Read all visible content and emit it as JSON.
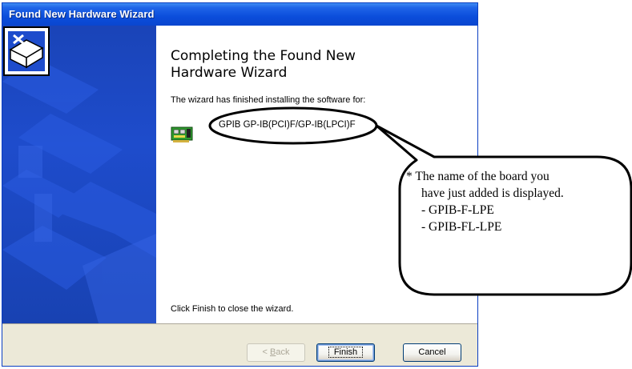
{
  "window": {
    "title": "Found New Hardware Wizard"
  },
  "content": {
    "heading_line1": "Completing the Found New",
    "heading_line2": "Hardware Wizard",
    "intro": "The wizard has finished installing the software for:",
    "device_name": "GPIB GP-IB(PCI)F/GP-IB(LPCI)F",
    "closing": "Click Finish to close the wizard."
  },
  "buttons": {
    "back_prefix": "< ",
    "back_accel": "B",
    "back_rest": "ack",
    "finish": "Finish",
    "cancel": "Cancel"
  },
  "callout": {
    "line1": "* The name of the board you",
    "line2": "have just added is displayed.",
    "line3": "- GPIB-F-LPE",
    "line4": "- GPIB-FL-LPE"
  },
  "icons": {
    "hardware": "hardware-install-icon",
    "device": "pci-card-icon"
  },
  "colors": {
    "titlebar": "#0b4ddb",
    "banner": "#1e4ccc",
    "footer": "#ece9d8"
  }
}
